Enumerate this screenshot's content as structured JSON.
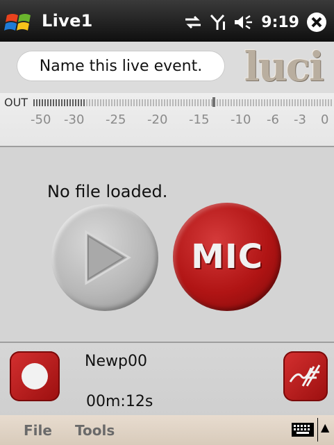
{
  "statusbar": {
    "app_title": "Live1",
    "clock": "9:19"
  },
  "event": {
    "name_placeholder": "Name this live event.",
    "logo_text": "luci"
  },
  "meter": {
    "label": "OUT",
    "scale": [
      "-50",
      "-30",
      "-25",
      "-20",
      "-15",
      "-10",
      "-6",
      "-3",
      "0"
    ]
  },
  "player": {
    "status": "No file loaded.",
    "mic_label": "MIC"
  },
  "recording": {
    "file_name": "Newp00",
    "duration": "00m:12s"
  },
  "menu": {
    "file": "File",
    "tools": "Tools"
  },
  "colors": {
    "accent_red": "#b01414",
    "titlebar": "#1a1a1a"
  }
}
